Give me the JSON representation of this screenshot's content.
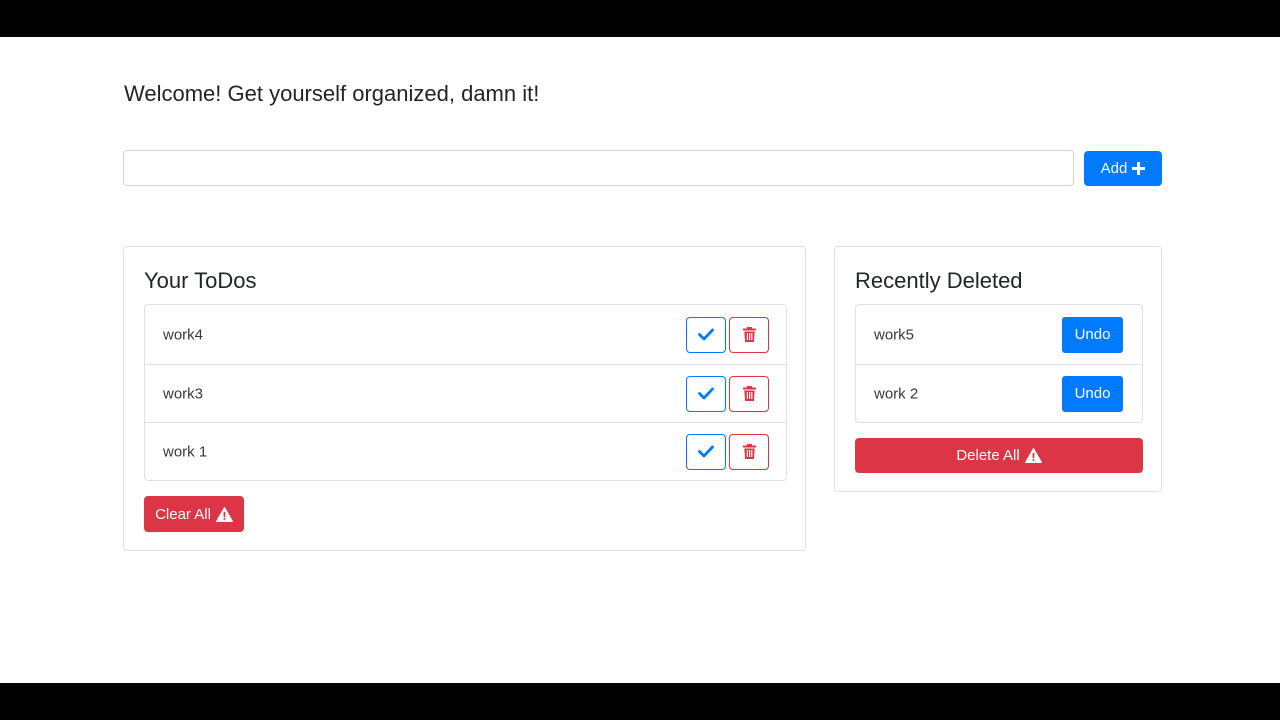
{
  "header": {
    "welcome": "Welcome! Get yourself organized, damn it!"
  },
  "input": {
    "value": "",
    "placeholder": ""
  },
  "add_button": {
    "label": "Add",
    "icon": "plus-icon"
  },
  "todos": {
    "title": "Your ToDos",
    "items": [
      {
        "label": "work4"
      },
      {
        "label": "work3"
      },
      {
        "label": "work 1"
      }
    ],
    "clear_label": "Clear All"
  },
  "deleted": {
    "title": "Recently Deleted",
    "items": [
      {
        "label": "work5",
        "undo_label": "Undo"
      },
      {
        "label": "work 2",
        "undo_label": "Undo"
      }
    ],
    "delete_all_label": "Delete All"
  },
  "colors": {
    "primary": "#007bff",
    "danger": "#dc3545",
    "border": "#dee2e6"
  }
}
